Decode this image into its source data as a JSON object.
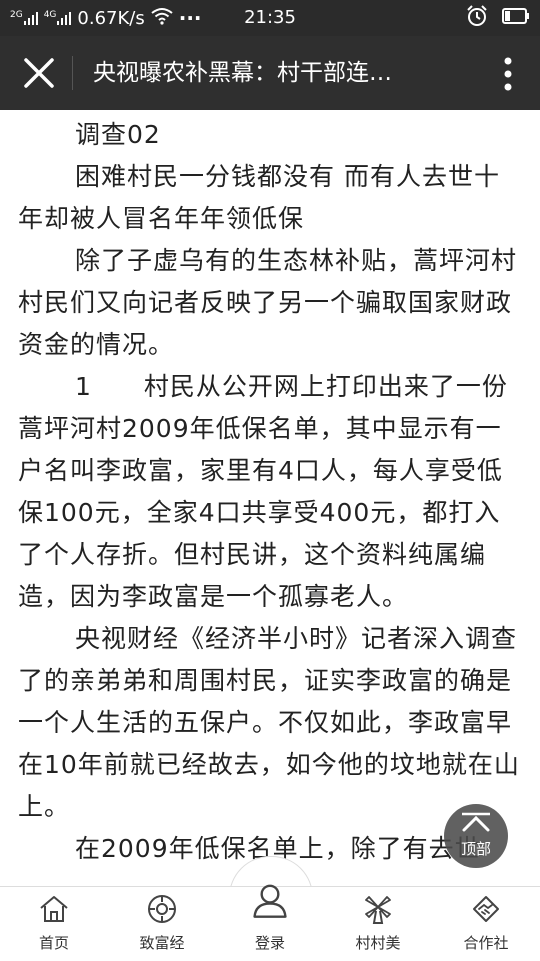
{
  "status_bar": {
    "signal1_tag": "2G",
    "signal2_tag": "4G",
    "speed": "0.67K/s",
    "dots": "···",
    "time": "21:35"
  },
  "title_bar": {
    "title": "央视曝农补黑幕：村干部连…"
  },
  "article": {
    "paragraphs": [
      "调查02",
      "困难村民一分钱都没有 而有人去世十年却被人冒名年年领低保",
      "除了子虚乌有的生态林补贴，蒿坪河村村民们又向记者反映了另一个骗取国家财政资金的情况。",
      "1　　村民从公开网上打印出来了一份蒿坪河村2009年低保名单，其中显示有一户名叫李政富，家里有4口人，每人享受低保100元，全家4口共享受400元，都打入了个人存折。但村民讲，这个资料纯属编造，因为李政富是一个孤寡老人。",
      "央视财经《经济半小时》记者深入调查了的亲弟弟和周围村民，证实李政富的确是一个人生活的五保户。不仅如此，李政富早在10年前就已经故去，如今他的坟地就在山上。",
      "在2009年低保名单上，除了有去世"
    ]
  },
  "back_to_top": {
    "label": "顶部"
  },
  "bottom_nav": [
    {
      "label": "首页",
      "icon": "home-icon"
    },
    {
      "label": "致富经",
      "icon": "compass-icon"
    },
    {
      "label": "登录",
      "icon": "user-icon"
    },
    {
      "label": "村村美",
      "icon": "windmill-icon"
    },
    {
      "label": "合作社",
      "icon": "handshake-icon"
    }
  ]
}
